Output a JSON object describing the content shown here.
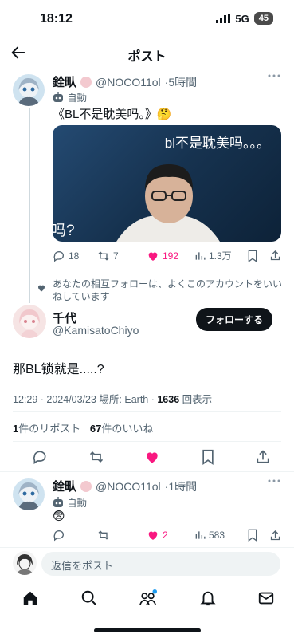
{
  "status_bar": {
    "time": "18:12",
    "network": "5G",
    "battery": "45"
  },
  "header": {
    "title": "ポスト"
  },
  "parent_post": {
    "display_name": "銓㽗",
    "handle": "@NOCO11ol",
    "time": "·5時間",
    "auto_label": "自動",
    "text": "《BL不是耽美吗。》🤔",
    "media": {
      "overlay_text": "bl不是耽美吗。。。",
      "corner_text": "吗?"
    },
    "actions": {
      "replies": "18",
      "reposts": "7",
      "likes": "192",
      "views": "1.3万"
    }
  },
  "social_context": "あなたの相互フォローは、よくこのアカウントをいいねしています",
  "main_post": {
    "display_name": "千代",
    "handle": "@KamisatoChiyo",
    "follow_label": "フォローする",
    "text": "那BL锁就是.....?",
    "meta_time": "12:29 · 2024/03/23 場所: Earth · ",
    "views_count": "1636",
    "views_label": " 回表示",
    "reposts_count": "1",
    "reposts_label": "件のリポスト",
    "likes_count": "67",
    "likes_label": "件のいいね"
  },
  "reply_post": {
    "display_name": "銓㽗",
    "handle": "@NOCO11ol",
    "time": "·1時間",
    "auto_label": "自動",
    "text": "😨",
    "actions": {
      "likes": "2",
      "views": "583"
    }
  },
  "composer": {
    "placeholder": "返信をポスト"
  },
  "colors": {
    "like": "#f91880",
    "text": "#0f1419",
    "muted": "#536471",
    "accent": "#1d9bf0"
  }
}
